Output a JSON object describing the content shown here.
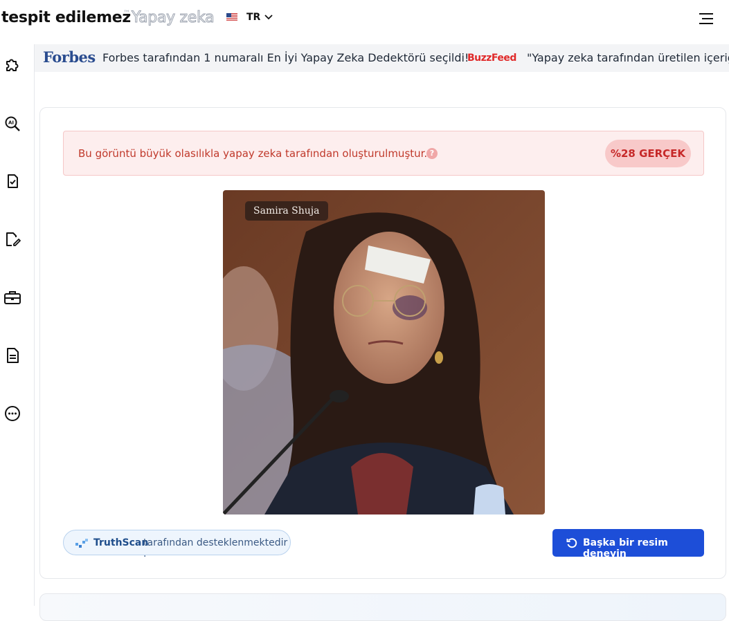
{
  "header": {
    "brand": "tespit edilemez",
    "trademark": "™",
    "brand_sub": "Yapay zeka",
    "language": "TR",
    "icons": {
      "flag": "us-flag-icon",
      "chevron": "chevron-down-icon",
      "menu": "hamburger-menu-icon"
    }
  },
  "sidebar": {
    "items": [
      {
        "name": "puzzle-icon"
      },
      {
        "name": "ai-search-icon"
      },
      {
        "name": "document-check-icon"
      },
      {
        "name": "document-edit-icon"
      },
      {
        "name": "briefcase-icon"
      },
      {
        "name": "document-text-icon"
      },
      {
        "name": "more-icon"
      }
    ]
  },
  "ticker": {
    "forbes_logo": "Forbes",
    "forbes_text": "Forbes tarafından 1 numaralı En İyi Yapay Zeka Dedektörü seçildi!",
    "buzzfeed_logo": "BuzzFeed",
    "buzzfeed_text": "\"Yapay zeka tarafından üretilen içeriği d"
  },
  "result": {
    "message": "Bu görüntü büyük olasılıkla yapay zeka tarafından oluşturulmuştur.",
    "help": "?",
    "badge": "%28 GERÇEK",
    "image_caption": "Samira Shuja",
    "colors": {
      "alert_bg": "#fdeeee",
      "alert_text": "#c0392b",
      "badge_bg": "#f8c9c9"
    }
  },
  "footer": {
    "powered_brand": "TruthScan",
    "powered_text": "tarafından desteklenmektedir .",
    "try_another": "Başka bir resim deneyin",
    "button_color": "#1d4ed8"
  }
}
